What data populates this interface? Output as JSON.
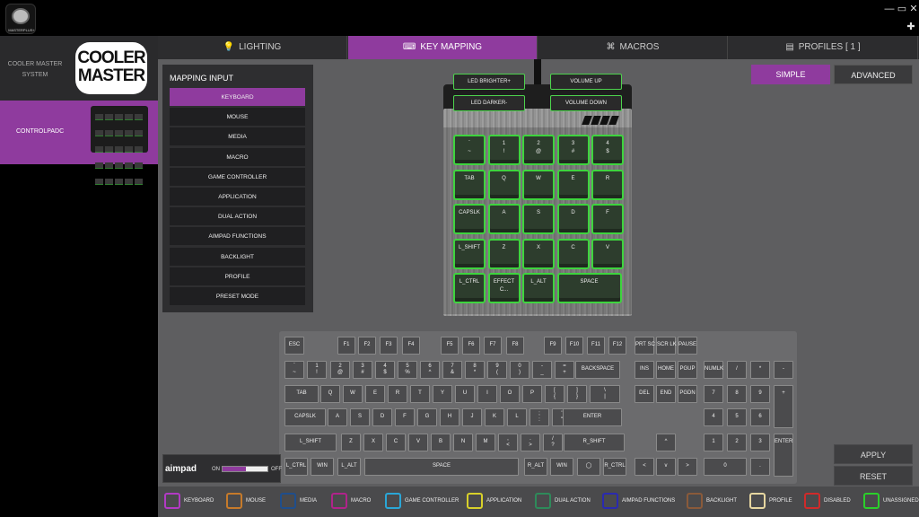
{
  "app": {
    "logo_text": "MASTERPLUS+",
    "min": "—",
    "max": "▭",
    "close": "✕",
    "pin": "✚"
  },
  "sidebar": {
    "system_label": "COOLER MASTER SYSTEM",
    "brand_logo": "COOLER MASTER",
    "device_label": "CONTROLPADC"
  },
  "tabs": [
    {
      "label": "LIGHTING",
      "icon": "bulb-icon"
    },
    {
      "label": "KEY MAPPING",
      "icon": "keyboard-icon"
    },
    {
      "label": "MACROS",
      "icon": "macro-icon"
    },
    {
      "label": "PROFILES [ 1 ]",
      "icon": "folder-icon"
    }
  ],
  "mapping": {
    "title": "MAPPING INPUT",
    "items": [
      "KEYBOARD",
      "MOUSE",
      "MEDIA",
      "MACRO",
      "GAME CONTROLLER",
      "APPLICATION",
      "DUAL ACTION",
      "AIMPAD FUNCTIONS",
      "BACKLIGHT",
      "PROFILE",
      "PRESET MODE"
    ]
  },
  "mode": {
    "simple": "SIMPLE",
    "advanced": "ADVANCED"
  },
  "top_keys": [
    "LED BRIGHTER+",
    "VOLUME UP",
    "LED DARKER-",
    "VOLUME DOWN"
  ],
  "pad_keys": [
    [
      "`\n~",
      "1\n!",
      "2\n@",
      "3\n#",
      "4\n$"
    ],
    [
      "TAB",
      "Q",
      "W",
      "E",
      "R"
    ],
    [
      "CAPSLK",
      "A",
      "S",
      "D",
      "F"
    ],
    [
      "L_SHIFT",
      "Z",
      "X",
      "C",
      "V"
    ],
    [
      "L_CTRL",
      "EFFECT\nC...",
      "L_ALT",
      "SPACE"
    ]
  ],
  "keyboard": {
    "row0": [
      "ESC",
      "F1",
      "F2",
      "F3",
      "F4",
      "F5",
      "F6",
      "F7",
      "F8",
      "F9",
      "F10",
      "F11",
      "F12",
      "PRT SC",
      "SCR LK",
      "PAUSE"
    ],
    "row1": [
      "`\n~",
      "1\n!",
      "2\n@",
      "3\n#",
      "4\n$",
      "5\n%",
      "6\n^",
      "7\n&",
      "8\n*",
      "9\n(",
      "0\n)",
      "-\n_",
      "=\n+",
      "BACKSPACE",
      "INS",
      "HOME",
      "PGUP",
      "NUMLK",
      "/",
      "*",
      "-"
    ],
    "row2": [
      "TAB",
      "Q",
      "W",
      "E",
      "R",
      "T",
      "Y",
      "U",
      "I",
      "O",
      "P",
      "[\n{",
      "]\n}",
      "\\\n|",
      "DEL",
      "END",
      "PGDN",
      "7",
      "8",
      "9",
      "+"
    ],
    "row3": [
      "CAPSLK",
      "A",
      "S",
      "D",
      "F",
      "G",
      "H",
      "J",
      "K",
      "L",
      ";\n:",
      "'\n\"",
      "ENTER",
      "4",
      "5",
      "6"
    ],
    "row4": [
      "L_SHIFT",
      "Z",
      "X",
      "C",
      "V",
      "B",
      "N",
      "M",
      ",\n<",
      ".\n>",
      "/\n?",
      "R_SHIFT",
      "^",
      "1",
      "2",
      "3",
      "ENTER"
    ],
    "row5": [
      "L_CTRL",
      "WIN",
      "L_ALT",
      "SPACE",
      "R_ALT",
      "WIN",
      "◯",
      "R_CTRL",
      "<",
      "v",
      ">",
      "0",
      "."
    ]
  },
  "aimpad": {
    "label": "aimpad",
    "on": "ON",
    "off": "OFF",
    "level": 0.5
  },
  "actions": {
    "apply": "APPLY",
    "reset": "RESET"
  },
  "legend": [
    {
      "label": "KEYBOARD",
      "color": "#b23ac4"
    },
    {
      "label": "MOUSE",
      "color": "#c67a2a"
    },
    {
      "label": "MEDIA",
      "color": "#1f4e8c"
    },
    {
      "label": "MACRO",
      "color": "#b0238a"
    },
    {
      "label": "GAME CONTROLLER",
      "color": "#2aa6d6"
    },
    {
      "label": "APPLICATION",
      "color": "#d8d02a"
    },
    {
      "label": "DUAL ACTION",
      "color": "#2e8a5a"
    },
    {
      "label": "AIMPAD FUNCTIONS",
      "color": "#2a2ab0"
    },
    {
      "label": "BACKLIGHT",
      "color": "#8a5a3a"
    },
    {
      "label": "PROFILE",
      "color": "#e6d6a0"
    },
    {
      "label": "DISABLED",
      "color": "#d02a2a"
    },
    {
      "label": "UNASSIGNED",
      "color": "#2ad02a"
    }
  ]
}
